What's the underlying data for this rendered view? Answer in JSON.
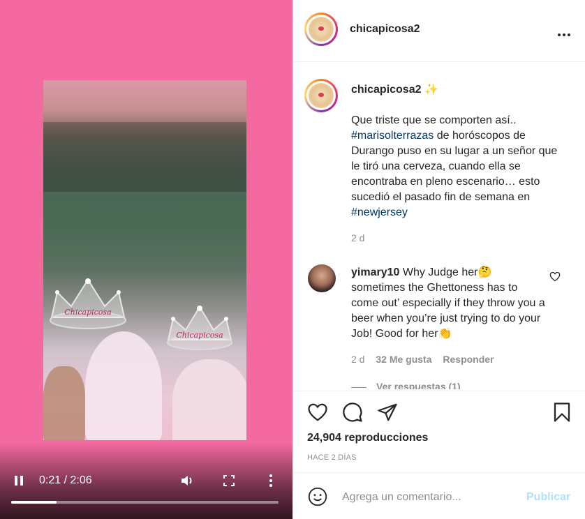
{
  "video": {
    "current_time": "0:21",
    "duration": "2:06",
    "progress": 0.17,
    "watermark": "Chicapicosa",
    "pause_icon": "pause-icon",
    "volume_icon": "volume-icon",
    "fullscreen_icon": "fullscreen-icon",
    "more_icon": "more-vertical-icon"
  },
  "header": {
    "username": "chicapicosa2",
    "more_icon": "more-horizontal-icon"
  },
  "post": {
    "username": "chicapicosa2",
    "emoji": "✨",
    "caption_1": "Que triste que se comporten así..",
    "tag_1": "#marisolterrazas",
    "caption_2": " de horóscopos de Durango puso en su lugar a un señor que le tiró una cerveza, cuando ella se encontraba en pleno escenario… esto sucedió el pasado fin de semana en",
    "tag_2": "#newjersey",
    "age": "2 d"
  },
  "comments": [
    {
      "username": "yimary10",
      "text": " Why Judge her🤔 sometimes the Ghettoness has to come out’ especially if they throw you a beer when you’re just trying to do your Job! Good for her👏",
      "age": "2 d",
      "likes": "32 Me gusta",
      "reply": "Responder",
      "view_replies": "Ver respuestas (1)"
    }
  ],
  "actions": {
    "views": "24,904 reproducciones",
    "posted": "HACE 2 DÍAS"
  },
  "composer": {
    "placeholder": "Agrega un comentario...",
    "publish": "Publicar",
    "emoji_icon": "emoji-icon"
  },
  "colors": {
    "video_background": "#f46aa0",
    "hashtag": "#00376b",
    "publish_disabled": "#b2dffc"
  }
}
